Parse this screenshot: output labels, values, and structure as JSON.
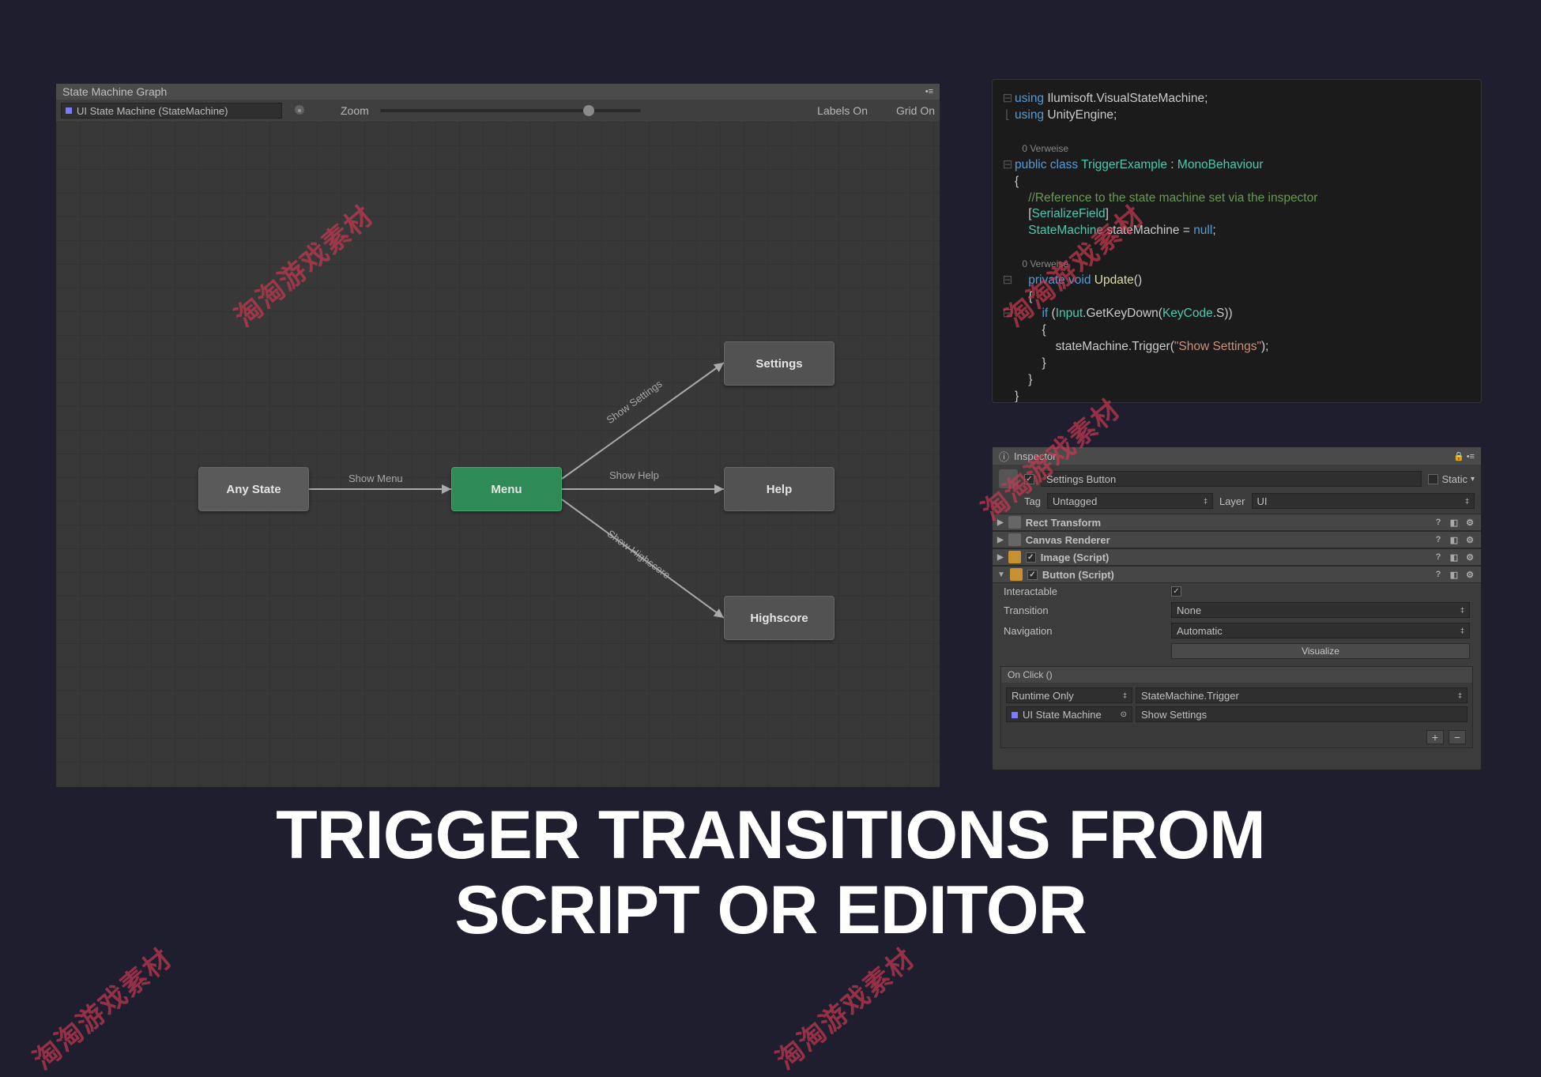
{
  "graph": {
    "title": "State Machine Graph",
    "object": "UI State Machine (StateMachine)",
    "zoom_label": "Zoom",
    "labels_toggle": "Labels On",
    "grid_toggle": "Grid On",
    "nodes": {
      "any": "Any State",
      "menu": "Menu",
      "settings": "Settings",
      "help": "Help",
      "highscore": "Highscore"
    },
    "edges": {
      "show_menu": "Show Menu",
      "show_settings": "Show Settings",
      "show_help": "Show Help",
      "show_highscore": "Show Highscore"
    }
  },
  "code": {
    "l1a": "using",
    "l1b": " Ilumisoft.VisualStateMachine;",
    "l2a": "using",
    "l2b": " UnityEngine;",
    "ref0": "0 Verweise",
    "l3a": "public class ",
    "l3b": "TriggerExample",
    "l3c": " : ",
    "l3d": "MonoBehaviour",
    "l4": "{",
    "c1": "    //Reference to the state machine set via the inspector",
    "l5a": "    [",
    "l5b": "SerializeField",
    "l5c": "]",
    "l6a": "    StateMachine",
    "l6b": " stateMachine = ",
    "l6c": "null",
    "l6d": ";",
    "l7a": "    private void ",
    "l7b": "Update",
    "l7c": "()",
    "l8": "    {",
    "l9a": "        if ",
    "l9b": "(",
    "l9c": "Input",
    "l9d": ".GetKeyDown(",
    "l9e": "KeyCode",
    "l9f": ".S))",
    "l10": "        {",
    "l11a": "            stateMachine.Trigger(",
    "l11b": "\"Show Settings\"",
    "l11c": ");",
    "l12": "        }",
    "l13": "    }",
    "l14": "}"
  },
  "inspector": {
    "title": "Inspector",
    "name": "Settings Button",
    "static": "Static",
    "tag_label": "Tag",
    "tag_value": "Untagged",
    "layer_label": "Layer",
    "layer_value": "UI",
    "components": {
      "rect": "Rect Transform",
      "canvas": "Canvas Renderer",
      "image": "Image (Script)",
      "button": "Button (Script)"
    },
    "props": {
      "interactable": "Interactable",
      "transition": "Transition",
      "transition_val": "None",
      "navigation": "Navigation",
      "navigation_val": "Automatic",
      "visualize": "Visualize"
    },
    "onclick": {
      "header": "On Click ()",
      "mode": "Runtime Only",
      "func": "StateMachine.Trigger",
      "target": "UI State Machine",
      "arg": "Show Settings"
    }
  },
  "watermark": "淘淘游戏素材",
  "headline1": "TRIGGER TRANSITIONS FROM",
  "headline2": "SCRIPT OR EDITOR"
}
